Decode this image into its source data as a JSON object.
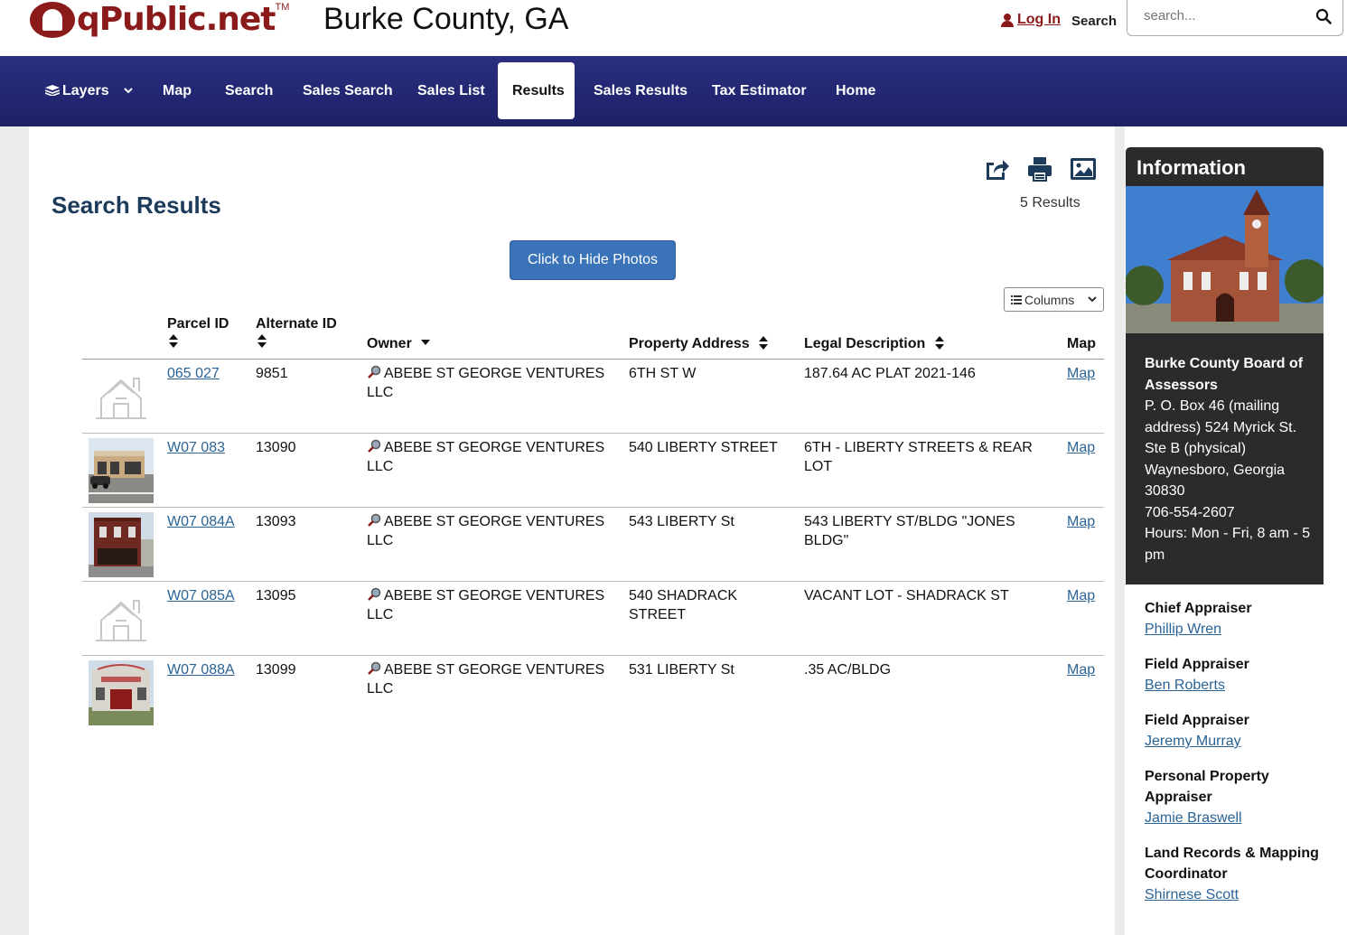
{
  "header": {
    "logo_text": "qPublic.net",
    "logo_tm": "TM",
    "county_title": "Burke County, GA",
    "login_label": "Log In",
    "search_label": "Search",
    "search_placeholder": "search..."
  },
  "nav": {
    "items": [
      {
        "label": "Layers",
        "icon": "layers-icon",
        "has_dropdown": true
      },
      {
        "label": "Map"
      },
      {
        "label": "Search"
      },
      {
        "label": "Sales Search"
      },
      {
        "label": "Sales List"
      },
      {
        "label": "Results",
        "active": true
      },
      {
        "label": "Sales Results"
      },
      {
        "label": "Tax Estimator"
      },
      {
        "label": "Home"
      }
    ]
  },
  "main": {
    "title": "Search Results",
    "results_count": "5 Results",
    "hide_photos_label": "Click to Hide Photos",
    "columns_label": "Columns",
    "toolbar_icons": [
      "share-icon",
      "print-icon",
      "image-icon"
    ]
  },
  "table": {
    "headers": {
      "parcel_id": "Parcel ID",
      "alternate_id": "Alternate ID",
      "owner": "Owner",
      "property_address": "Property Address",
      "legal_description": "Legal Description",
      "map": "Map"
    },
    "rows": [
      {
        "photo": "placeholder-house",
        "parcel_id": "065 027",
        "alternate_id": "9851",
        "owner_line1": "ABEBE ST GEORGE VENTURES",
        "owner_line2": "LLC",
        "address_line1": "6TH ST W",
        "address_line2": "",
        "legal_line1": "187.64 AC PLAT 2021-146",
        "legal_line2": "",
        "map": "Map"
      },
      {
        "photo": "photo-storefront",
        "parcel_id": "W07 083",
        "alternate_id": "13090",
        "owner_line1": "ABEBE ST GEORGE VENTURES",
        "owner_line2": "LLC",
        "address_line1": "540 LIBERTY STREET",
        "address_line2": "",
        "legal_line1": "6TH - LIBERTY STREETS & REAR LOT",
        "legal_line2": "",
        "map": "Map"
      },
      {
        "photo": "photo-brick-building",
        "parcel_id": "W07 084A",
        "alternate_id": "13093",
        "owner_line1": "ABEBE ST GEORGE VENTURES",
        "owner_line2": "LLC",
        "address_line1": "543 LIBERTY St",
        "address_line2": "",
        "legal_line1": "543 LIBERTY ST/BLDG \"JONES",
        "legal_line2": "BLDG\"",
        "map": "Map"
      },
      {
        "photo": "placeholder-house",
        "parcel_id": "W07 085A",
        "alternate_id": "13095",
        "owner_line1": "ABEBE ST GEORGE VENTURES",
        "owner_line2": "LLC",
        "address_line1": "540 SHADRACK",
        "address_line2": "STREET",
        "legal_line1": "VACANT LOT - SHADRACK ST",
        "legal_line2": "",
        "map": "Map"
      },
      {
        "photo": "photo-old-building",
        "parcel_id": "W07 088A",
        "alternate_id": "13099",
        "owner_line1": "ABEBE ST GEORGE VENTURES",
        "owner_line2": "LLC",
        "address_line1": "531 LIBERTY St",
        "address_line2": "",
        "legal_line1": ".35 AC/BLDG",
        "legal_line2": "",
        "map": "Map"
      }
    ]
  },
  "sidebar": {
    "info_title": "Information",
    "org_name": "Burke County Board of Assessors",
    "address": "P. O. Box 46 (mailing address) 524 Myrick St. Ste B (physical) Waynesboro, Georgia 30830",
    "phone": "706-554-2607",
    "hours": "Hours: Mon - Fri, 8 am - 5 pm",
    "staff": [
      {
        "role": "Chief Appraiser",
        "name": "Phillip Wren"
      },
      {
        "role": "Field Appraiser",
        "name": "Ben Roberts"
      },
      {
        "role": "Field Appraiser",
        "name": "Jeremy Murray"
      },
      {
        "role": "Personal Property Appraiser",
        "name": "Jamie Braswell"
      },
      {
        "role": "Land Records & Mapping Coordinator",
        "name": "Shirnese Scott"
      }
    ]
  },
  "colors": {
    "brand_red": "#8b1a1a",
    "nav_blue": "#1d2166",
    "title_blue": "#1c3a5a",
    "button_blue": "#3a73b8",
    "link_blue": "#2a6496",
    "info_dark": "#2b2b2b"
  }
}
